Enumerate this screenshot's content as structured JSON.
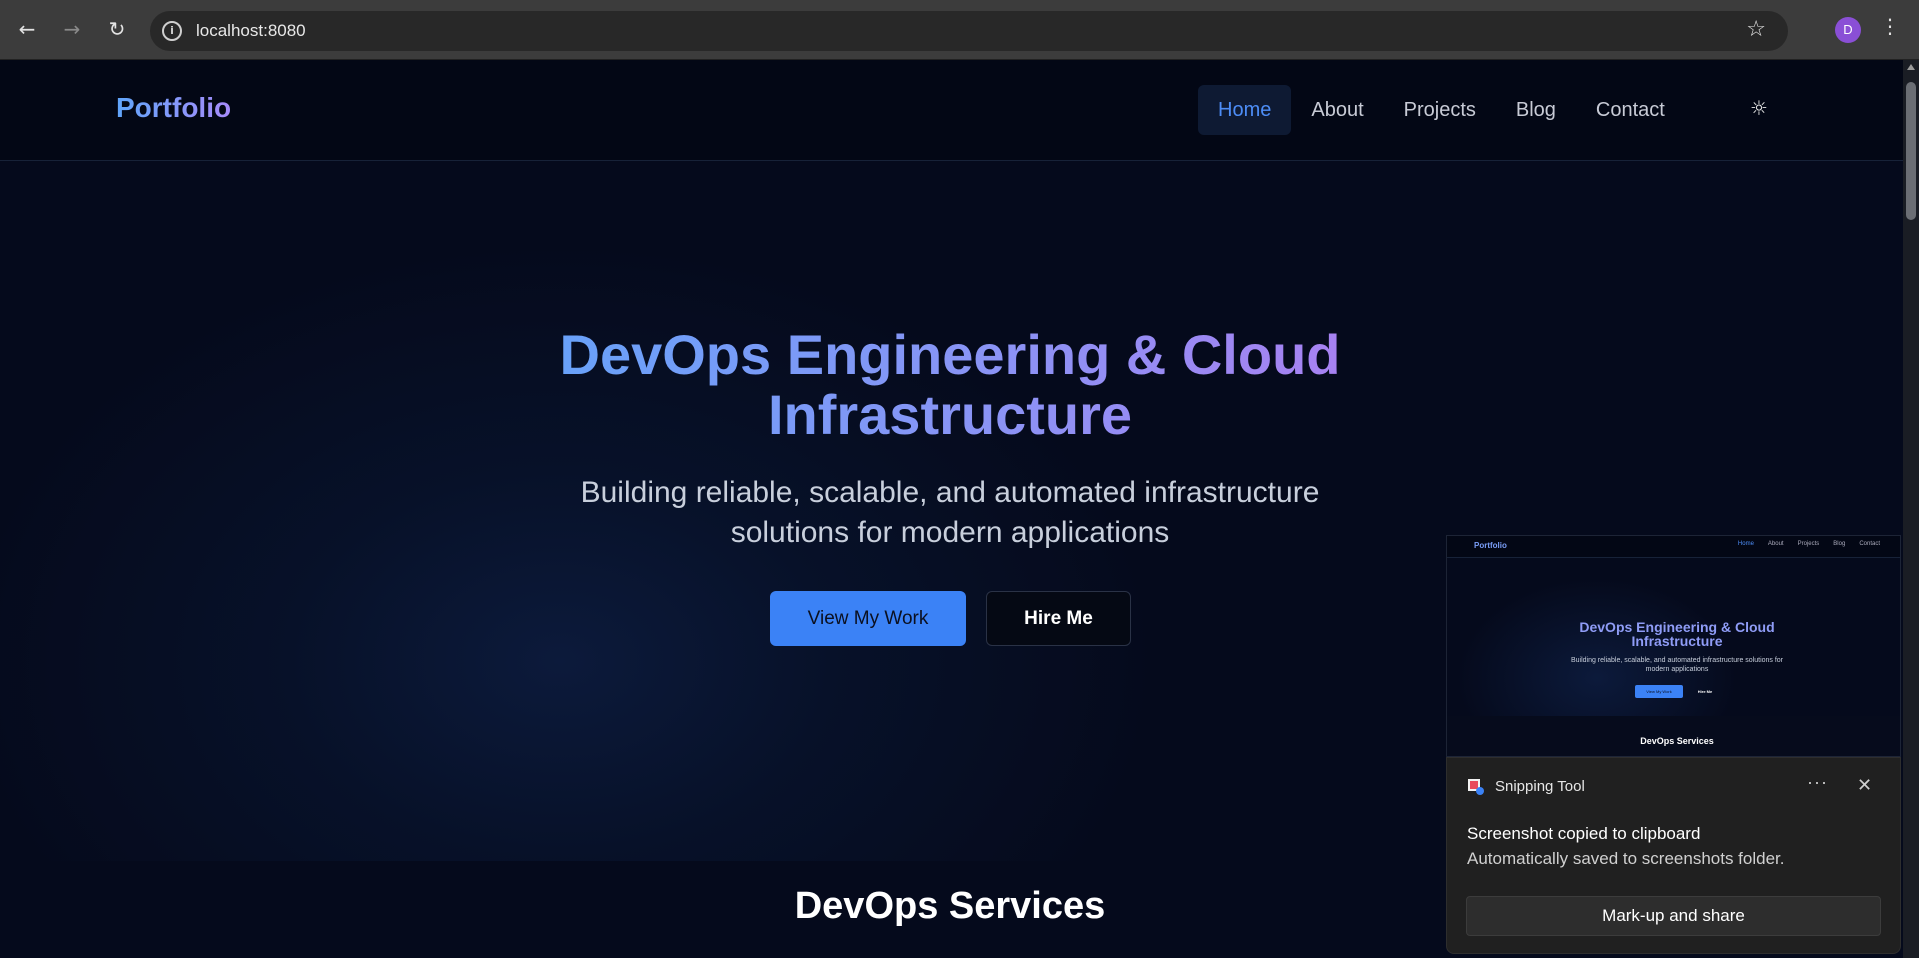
{
  "browser": {
    "url": "localhost:8080",
    "back_icon": "arrow-left-icon",
    "forward_icon": "arrow-right-icon",
    "reload_icon": "reload-icon",
    "profile_initial": "D",
    "profile_color": "#8a4fd6"
  },
  "site": {
    "brand": "Portfolio",
    "nav": [
      {
        "label": "Home",
        "active": true
      },
      {
        "label": "About"
      },
      {
        "label": "Projects"
      },
      {
        "label": "Blog"
      },
      {
        "label": "Contact"
      }
    ],
    "theme_icon": "sun-icon",
    "accent": "#3b82f6"
  },
  "hero": {
    "title_line1": "DevOps Engineering & Cloud",
    "title_line2": "Infrastructure",
    "subtitle_line1": "Building reliable, scalable, and automated infrastructure",
    "subtitle_line2": "solutions for modern applications",
    "primary_button": "View My Work",
    "secondary_button": "Hire Me"
  },
  "services": {
    "title": "DevOps Services"
  },
  "snip_preview": {
    "brand": "Portfolio",
    "nav": [
      "Home",
      "About",
      "Projects",
      "Blog",
      "Contact"
    ],
    "title": "DevOps Engineering & Cloud Infrastructure",
    "subtitle": "Building reliable, scalable, and automated infrastructure solutions for modern applications",
    "primary_button": "View My Work",
    "secondary_button": "Hire Me",
    "services_title": "DevOps Services"
  },
  "toast": {
    "app_name": "Snipping Tool",
    "message": "Screenshot copied to clipboard",
    "detail": "Automatically saved to screenshots folder.",
    "action": "Mark-up and share"
  }
}
